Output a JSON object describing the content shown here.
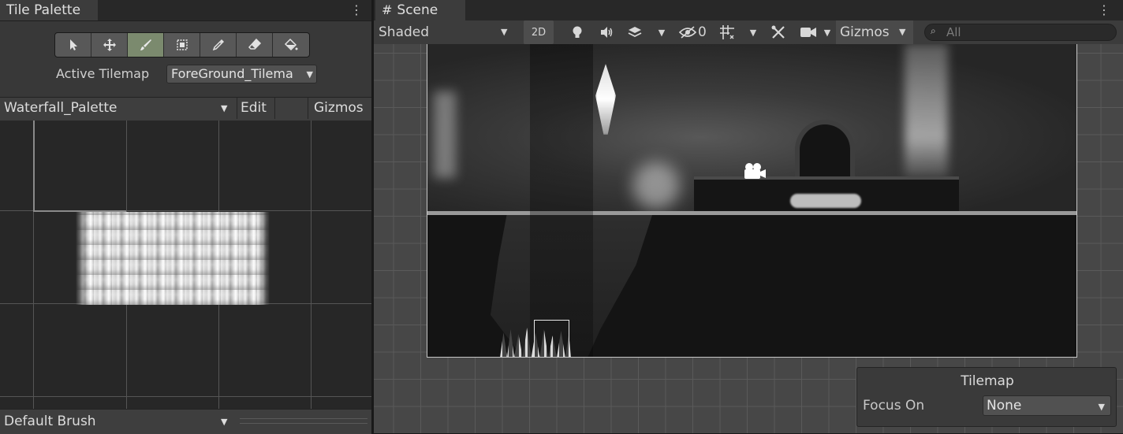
{
  "left_panel": {
    "tab_title": "Tile Palette",
    "tools": [
      {
        "name": "select-tool",
        "icon": "arrow-icon"
      },
      {
        "name": "move-tool",
        "icon": "move-arrows-icon"
      },
      {
        "name": "paint-tool",
        "icon": "brush-icon",
        "active": true
      },
      {
        "name": "box-fill-tool",
        "icon": "box-icon"
      },
      {
        "name": "picker-tool",
        "icon": "eyedropper-icon"
      },
      {
        "name": "erase-tool",
        "icon": "eraser-icon"
      },
      {
        "name": "fill-tool",
        "icon": "bucket-icon"
      }
    ],
    "active_tilemap_label": "Active Tilemap",
    "active_tilemap_value": "ForeGround_Tilema",
    "palette_name": "Waterfall_Palette",
    "edit_label": "Edit",
    "gizmos_label": "Gizmos",
    "brush_name": "Default Brush"
  },
  "scene_panel": {
    "tab_title": "Scene",
    "shading_mode": "Shaded",
    "mode_2d_label": "2D",
    "hidden_count": "0",
    "gizmos_label": "Gizmos",
    "search_placeholder": "All"
  },
  "tilemap_overlay": {
    "title": "Tilemap",
    "focus_label": "Focus On",
    "focus_value": "None"
  },
  "colors": {
    "active_tool": "#7b8a6e",
    "panel_bg": "#383838",
    "scene_bg": "#474747"
  }
}
